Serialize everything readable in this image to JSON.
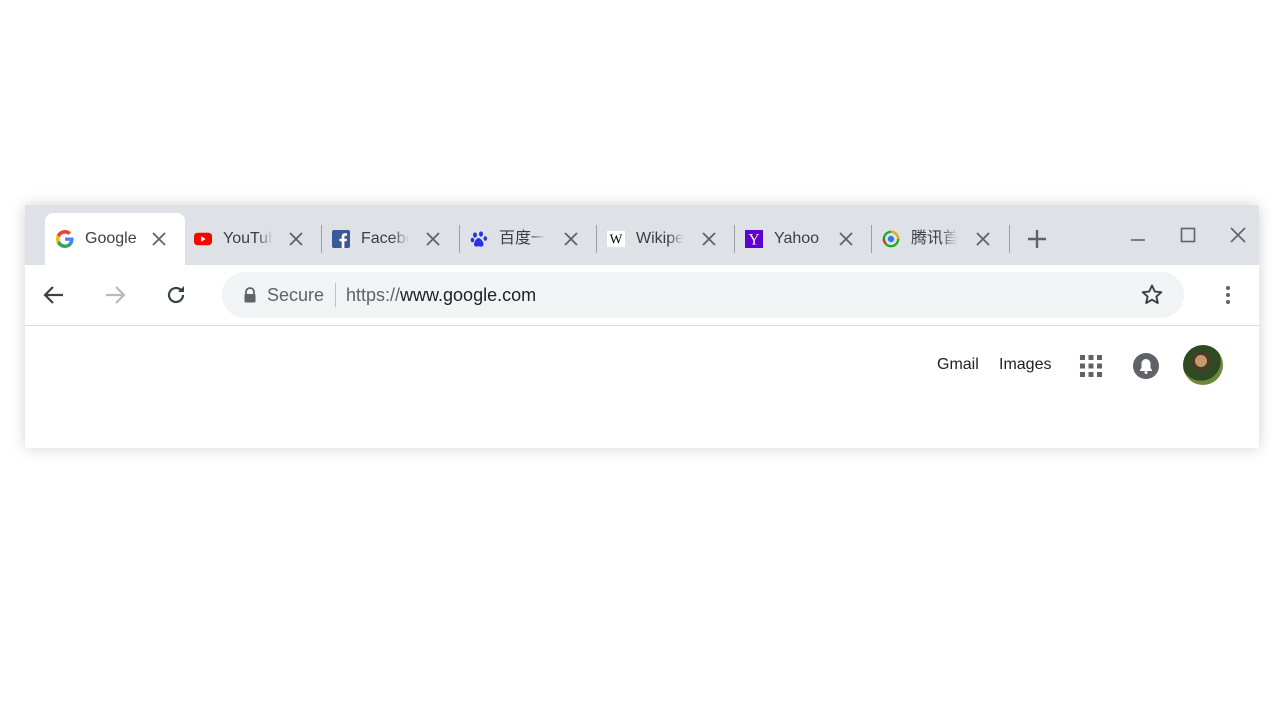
{
  "tabs": [
    {
      "title": "Google",
      "favicon": "google-g-icon",
      "active": true
    },
    {
      "title": "YouTube",
      "favicon": "youtube-icon",
      "active": false
    },
    {
      "title": "Facebook",
      "favicon": "facebook-icon",
      "active": false
    },
    {
      "title": "百度一下",
      "favicon": "baidu-paw-icon",
      "active": false
    },
    {
      "title": "Wikipedia",
      "favicon": "wikipedia-w-icon",
      "active": false
    },
    {
      "title": "Yahoo",
      "favicon": "yahoo-y-icon",
      "active": false
    },
    {
      "title": "腾讯首页",
      "favicon": "tencent-icon",
      "active": false
    }
  ],
  "omnibox": {
    "security_label": "Secure",
    "url_scheme": "https://",
    "url_host": "www.google.com"
  },
  "google_bar": {
    "gmail_label": "Gmail",
    "images_label": "Images"
  },
  "colors": {
    "tabstrip_bg": "#dee1e6",
    "omnibox_bg": "#f1f3f4",
    "youtube_red": "#ff0000",
    "facebook_blue": "#3b5998",
    "yahoo_purple": "#5f01d1",
    "baidu_blue": "#2932e1"
  }
}
